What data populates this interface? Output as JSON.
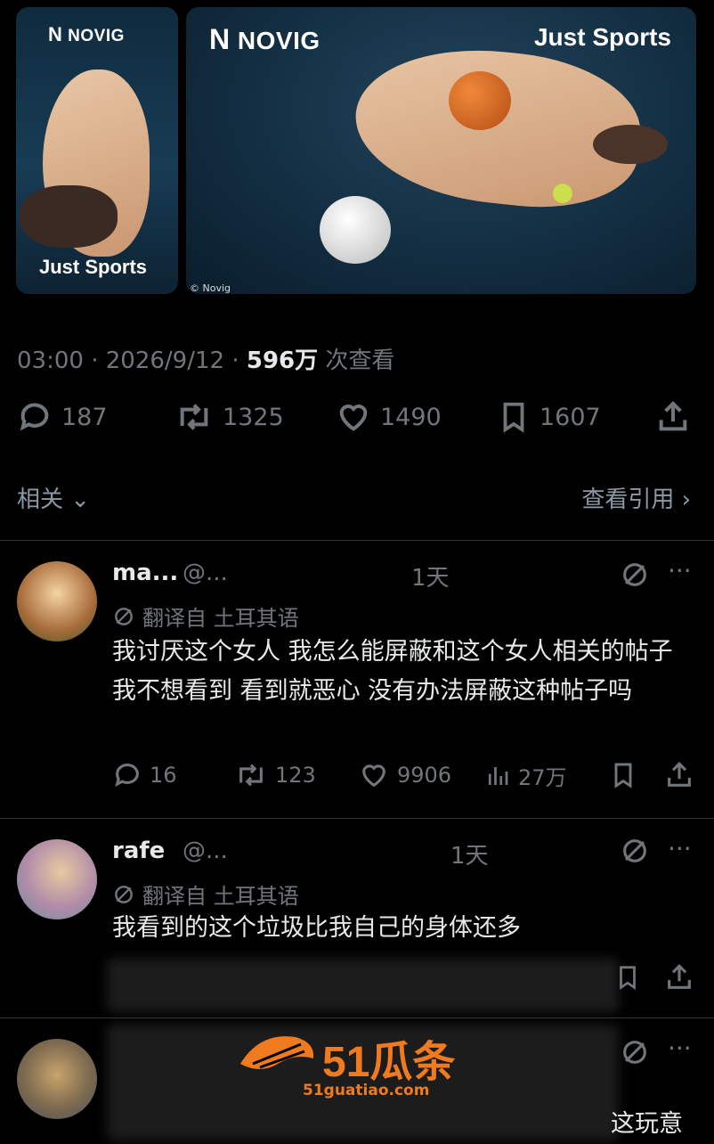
{
  "media": {
    "left": {
      "brand": "NOVIG",
      "tagline": "Just Sports"
    },
    "right": {
      "brand": "NOVIG",
      "tagline": "Just Sports",
      "credit": "© Novig"
    }
  },
  "post": {
    "time": "03:00",
    "date": "2026/9/12",
    "views_count": "596万",
    "views_label": "次查看",
    "stats": {
      "replies": "187",
      "reposts": "1325",
      "likes": "1490",
      "bookmarks": "1607"
    }
  },
  "related_label": "相关",
  "quotes_label": "查看引用",
  "replies": [
    {
      "name": "ma...",
      "handle": "@...",
      "age": "1天",
      "translated": "翻译自 土耳其语",
      "text": "我讨厌这个女人 我怎么能屏蔽和这个女人相关的帖子 我不想看到 看到就恶心 没有办法屏蔽这种帖子吗",
      "replies": "16",
      "reposts": "123",
      "likes": "9906",
      "views": "27万"
    },
    {
      "name": "rafe",
      "handle": "@...",
      "age": "1天",
      "translated": "翻译自 土耳其语",
      "text": "我看到的这个垃圾比我自己的身体还多"
    },
    {
      "text_tail": "这玩意"
    }
  ],
  "watermark": {
    "brand": "51瓜条",
    "url": "51guatiao.com"
  },
  "colors": {
    "background": "#000000",
    "text": "#e7e9ea",
    "muted": "#71767b",
    "watermark": "#f07a1e"
  }
}
